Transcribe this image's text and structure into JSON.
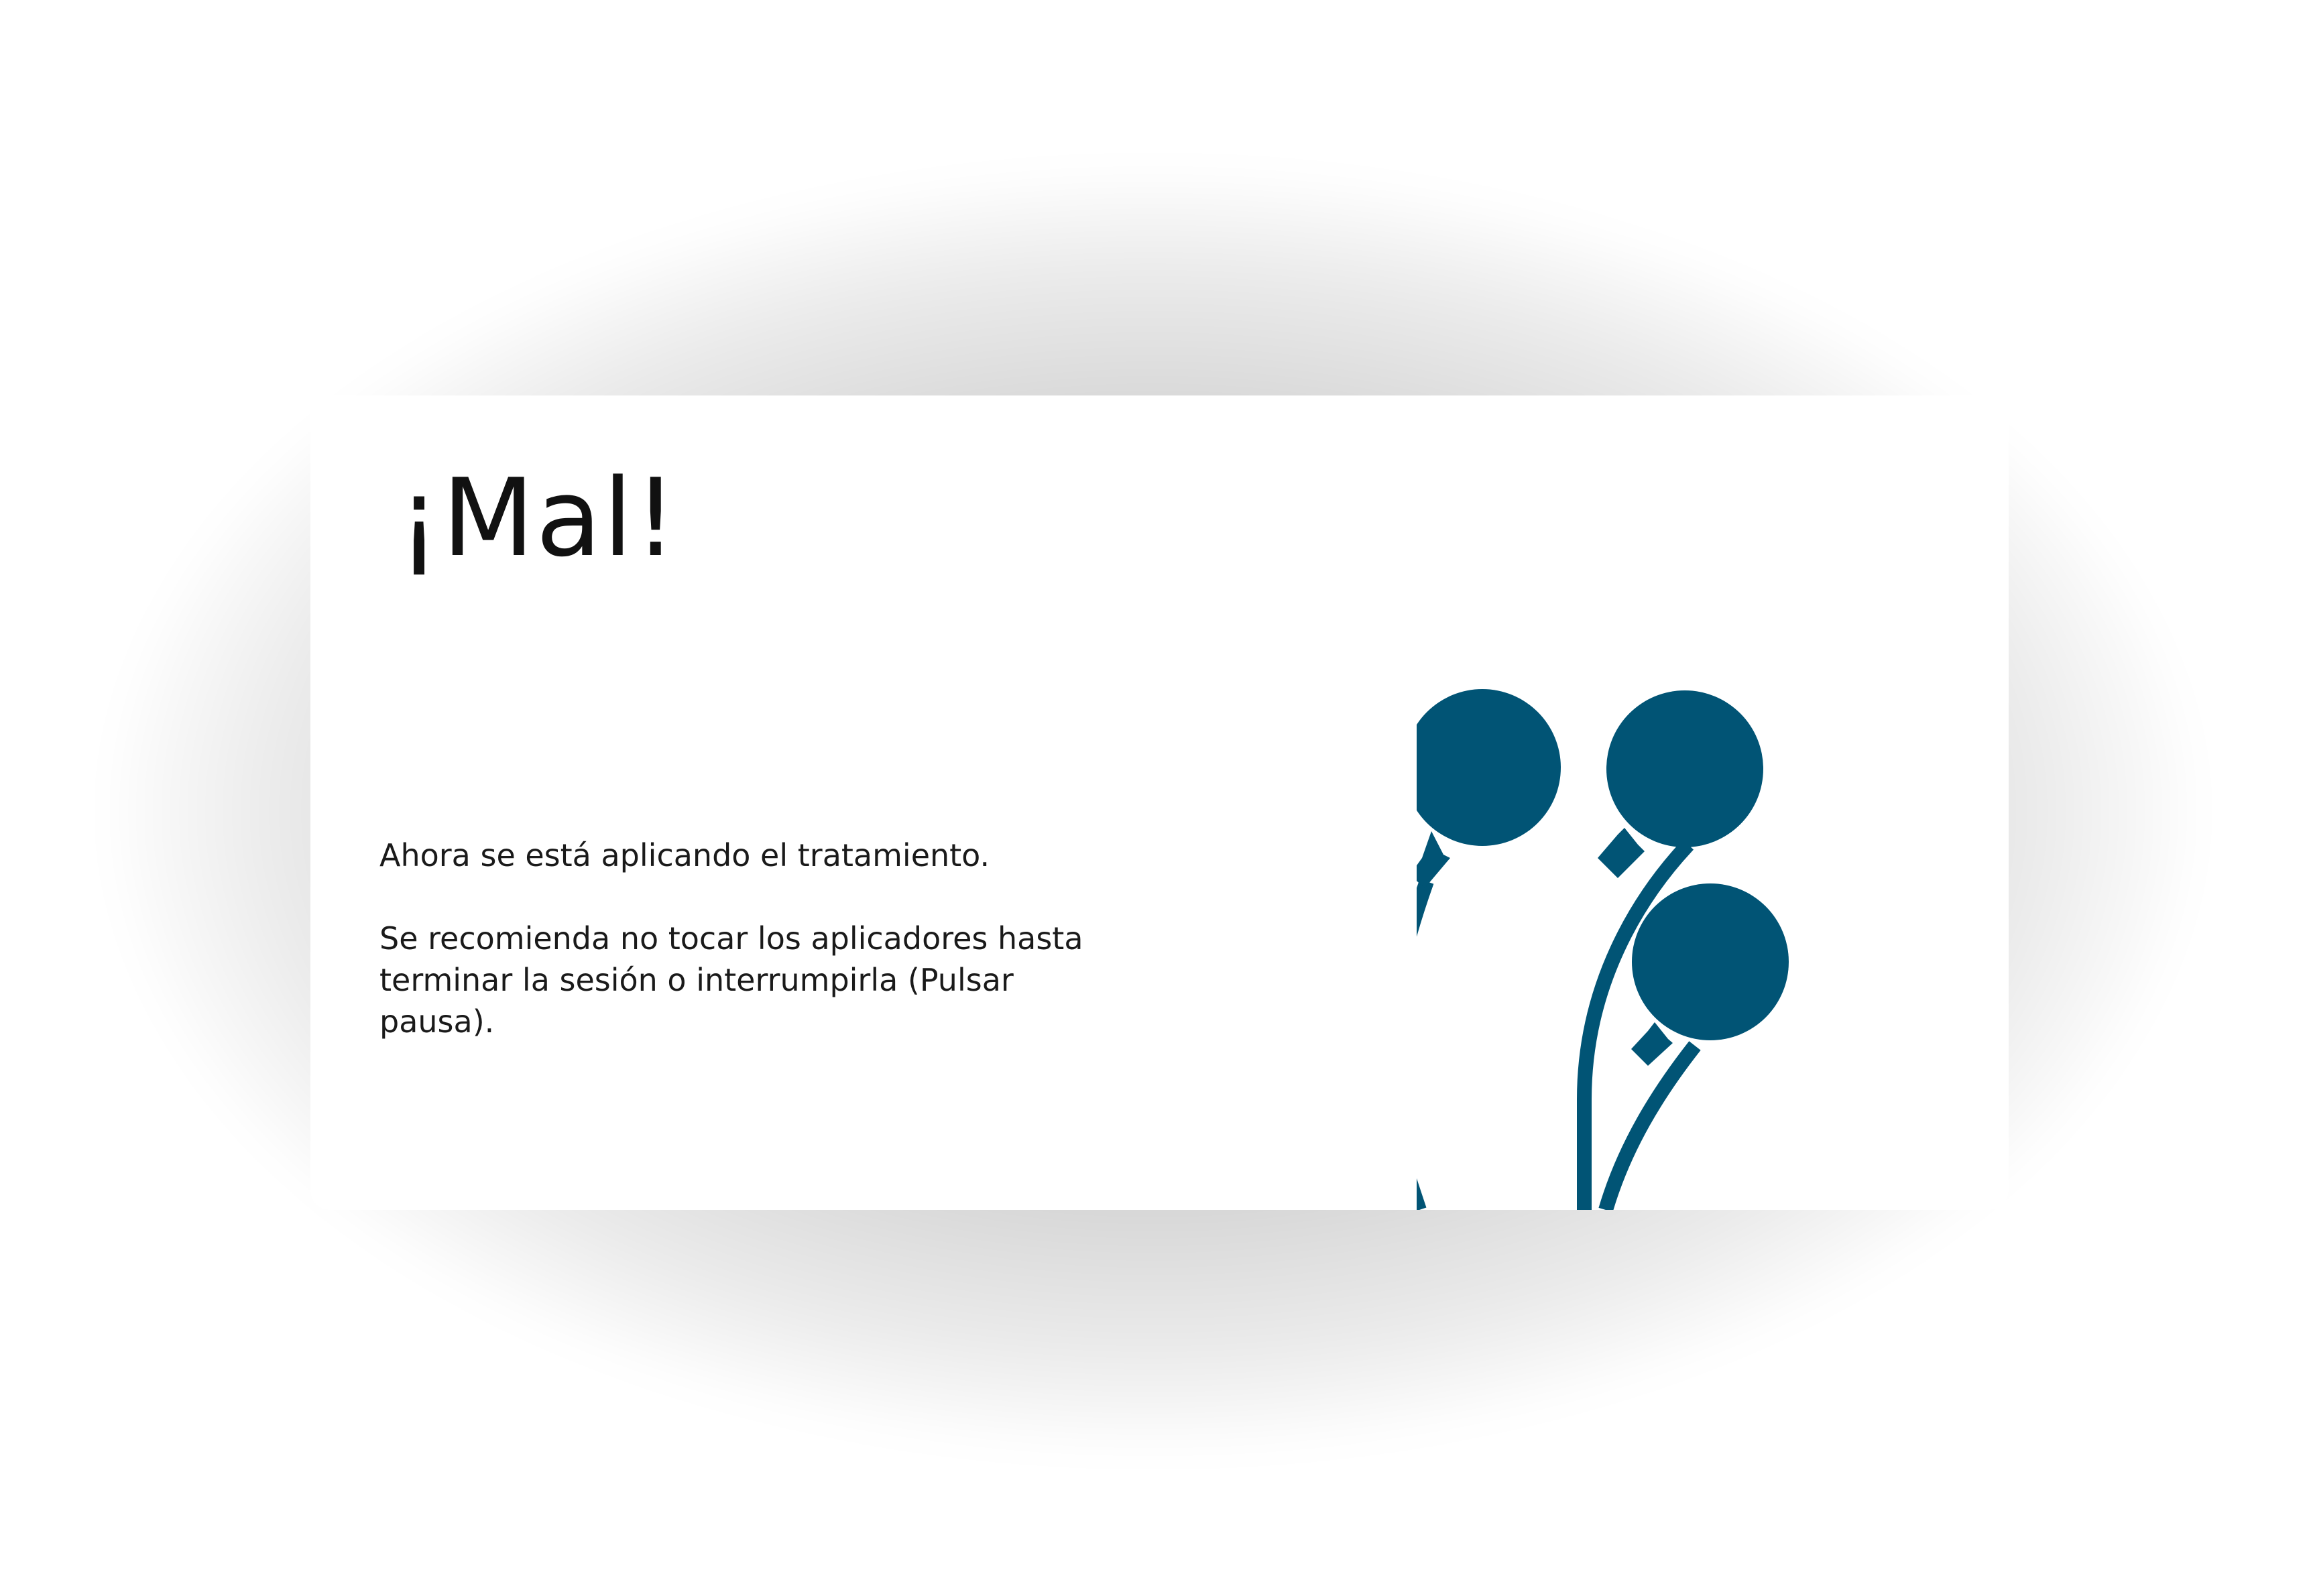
{
  "dialog": {
    "title": "¡Mal!",
    "message_line1": "Ahora se está aplicando el tratamiento.",
    "message_line2": "Se recomienda no tocar los aplicadores hasta terminar la sesión o interrumpirla (Pulsar pausa)."
  },
  "illustration": {
    "icon": "applicators-icon",
    "color": "#015475"
  }
}
